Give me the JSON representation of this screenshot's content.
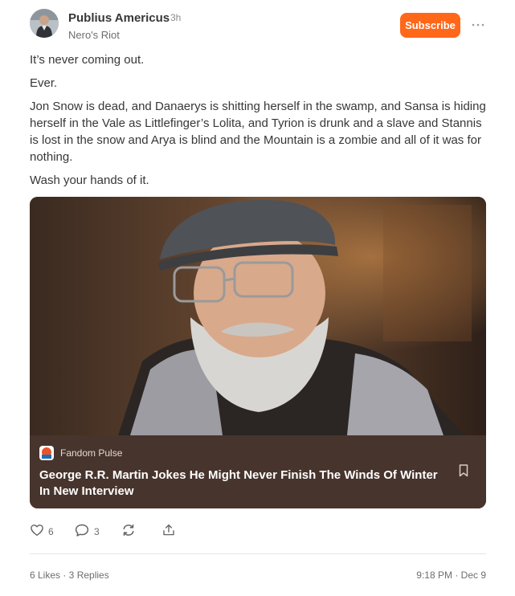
{
  "post": {
    "author": "Publius Americus",
    "time_ago": "3h",
    "publication": "Nero's Riot",
    "subscribe_label": "Subscribe",
    "more_label": "···",
    "paragraphs": [
      "It’s never coming out.",
      "Ever.",
      "Jon Snow is dead, and Danaerys is shitting herself in the swamp, and Sansa is hiding herself in the Vale as Littlefinger’s Lolita, and Tyrion is drunk and a slave and Stannis is lost in the snow and Arya is blind and the Mountain is a zombie and all of it was for nothing.",
      "Wash your hands of it."
    ]
  },
  "embed": {
    "source": "Fandom Pulse",
    "title": "George R.R. Martin Jokes He Might Never Finish The Winds Of Winter In New Interview"
  },
  "actions": {
    "likes_count": "6",
    "comments_count": "3"
  },
  "footer": {
    "stats": "6 Likes · 3 Replies",
    "timestamp": "9:18 PM · Dec 9"
  },
  "colors": {
    "accent": "#ff6719",
    "embed_bg": "#47342d"
  },
  "icons": [
    "avatar",
    "more-icon",
    "bookmark-icon",
    "heart-icon",
    "comment-icon",
    "restack-icon",
    "share-icon",
    "fandom-pulse-logo"
  ]
}
